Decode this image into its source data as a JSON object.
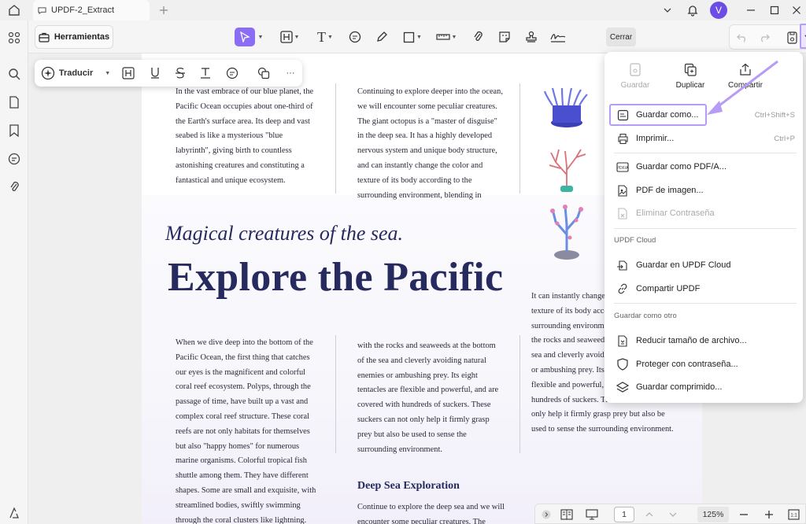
{
  "titlebar": {
    "tab_title": "UPDF-2_Extract",
    "avatar_letter": "V"
  },
  "toolbar": {
    "herramientas_label": "Herramientas",
    "cerrar_label": "Cerrar",
    "accent_color": "#8b6cf5"
  },
  "floating_toolbar": {
    "traducir_label": "Traducir",
    "more_label": "···"
  },
  "document": {
    "col1_top": "In the vast embrace of our blue planet, the Pacific Ocean occupies about one-third of the Earth's surface area. Its deep and vast seabed is like a mysterious \"blue labyrinth\", giving birth to countless astonishing creatures and constituting a fantastical and unique ecosystem.",
    "col2_top": "Continuing to explore deeper into the ocean, we will encounter some peculiar creatures. The giant octopus is a \"master of disguise\" in the deep sea. It has a highly developed nervous system and unique body structure, and can instantly change the color and texture of its body according to the surrounding environment, blending in",
    "magic_title": "Magical creatures of the sea.",
    "explore_title": "Explore the Pacific",
    "col1_bottom": "When we dive deep into the bottom of the Pacific Ocean, the first thing that catches our eyes is the magnificent and colorful coral reef ecosystem. Polyps, through the passage of time, have built up a vast and complex coral reef structure. These coral reefs are not only habitats for themselves but also \"happy homes\" for numerous marine organisms. Colorful tropical fish shuttle among them. They have different shapes. Some are small and exquisite, with streamlined bodies, swiftly swimming through the coral clusters like lightning.",
    "col2_bottom": "with the rocks and seaweeds at the bottom of the sea and cleverly avoiding natural enemies or ambushing prey. Its eight tentacles are flexible and powerful, and are covered with hundreds of suckers. These suckers can not only help it firmly grasp prey but also be used to sense the surrounding environment.",
    "col3_bottom": "It can instantly change the color and texture of its body according to the surrounding environment, blending in with the rocks and seaweeds at the bottom of the sea and cleverly avoiding natural enemies or ambushing prey. Its eight tentacles are flexible and powerful, and are covered with hundreds of suckers. These suckers can not only help it firmly grasp prey but also be used to sense the surrounding environment.",
    "deep_title": "Deep Sea Exploration",
    "deep_text": "Continue to explore the deep sea and we will encounter some peculiar creatures. The"
  },
  "menu": {
    "top": {
      "guardar": "Guardar",
      "duplicar": "Duplicar",
      "compartir": "Compartir"
    },
    "guardar_como": {
      "label": "Guardar como...",
      "shortcut": "Ctrl+Shift+S"
    },
    "imprimir": {
      "label": "Imprimir...",
      "shortcut": "Ctrl+P"
    },
    "pdfa": "Guardar como PDF/A...",
    "pdf_imagen": "PDF de imagen...",
    "eliminar": "Eliminar Contraseña",
    "section_cloud": "UPDF Cloud",
    "guardar_cloud": "Guardar en UPDF Cloud",
    "compartir_updf": "Compartir UPDF",
    "section_otro": "Guardar como otro",
    "reducir": "Reducir tamaño de archivo...",
    "proteger": "Proteger con contraseña...",
    "comprimido": "Guardar comprimido...",
    "highlight_color": "#b69cf6"
  },
  "bottombar": {
    "page_number": "1",
    "zoom": "125%"
  }
}
